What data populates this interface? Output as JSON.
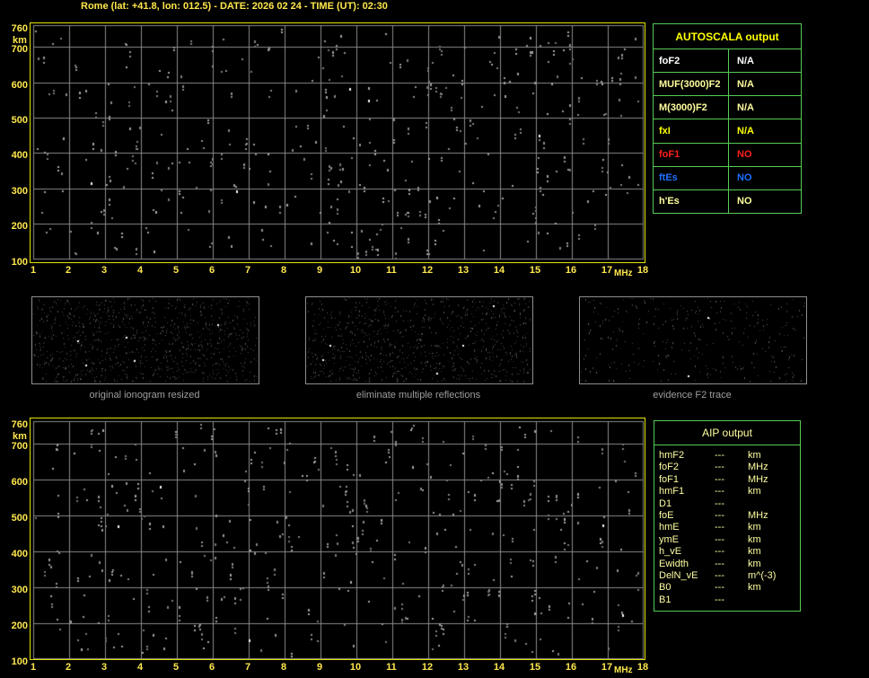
{
  "title": "Rome (lat: +41.8, lon: 012.5) - DATE: 2026 02 24 - TIME (UT): 02:30",
  "colors": {
    "background": "#000000",
    "plot_border": "#E4E400",
    "grid": "#8A8A8A",
    "axis_label": "#FFE84D",
    "table_border": "#55CC55",
    "bright_yellow": "#FFFF00",
    "pale_yellow": "#FFFF9E",
    "white": "#FFFFFF",
    "red": "#FF1F1F",
    "blue": "#1F6FFF",
    "thumb_border": "#8E8E8E",
    "caption_gray": "#9E9E9E"
  },
  "ionogram_axes": {
    "y_unit": "km",
    "x_unit": "MHz",
    "y_ticks": [
      760,
      700,
      600,
      500,
      400,
      300,
      200,
      100
    ],
    "x_ticks": [
      1,
      2,
      3,
      4,
      5,
      6,
      7,
      8,
      9,
      10,
      11,
      12,
      13,
      14,
      15,
      16,
      17,
      18
    ],
    "y_range": [
      100,
      760
    ],
    "x_range": [
      1,
      18
    ]
  },
  "autoscala_table": {
    "header": "AUTOSCALA output",
    "rows": [
      {
        "param": "foF2",
        "value": "N/A",
        "color": "#FFFFFF"
      },
      {
        "param": "MUF(3000)F2",
        "value": "N/A",
        "color": "#FFFF9E"
      },
      {
        "param": "M(3000)F2",
        "value": "N/A",
        "color": "#FFFF9E"
      },
      {
        "param": "fxI",
        "value": "N/A",
        "color": "#FFFF00"
      },
      {
        "param": "foF1",
        "value": "NO",
        "color": "#FF1F1F"
      },
      {
        "param": "ftEs",
        "value": "NO",
        "color": "#1F6FFF"
      },
      {
        "param": "h'Es",
        "value": "NO",
        "color": "#FFFF9E"
      }
    ]
  },
  "thumbnails": [
    {
      "caption": "original ionogram resized"
    },
    {
      "caption": "eliminate multiple reflections"
    },
    {
      "caption": "evidence F2 trace"
    }
  ],
  "aip_table": {
    "header": "AIP output",
    "rows": [
      {
        "param": "hmF2",
        "value": "---",
        "unit": "km"
      },
      {
        "param": "foF2",
        "value": "---",
        "unit": "MHz"
      },
      {
        "param": "foF1",
        "value": "---",
        "unit": "MHz"
      },
      {
        "param": "hmF1",
        "value": "---",
        "unit": "km"
      },
      {
        "param": "D1",
        "value": "---",
        "unit": ""
      },
      {
        "param": "foE",
        "value": "---",
        "unit": "MHz"
      },
      {
        "param": "hmE",
        "value": "---",
        "unit": "km"
      },
      {
        "param": "ymE",
        "value": "---",
        "unit": "km"
      },
      {
        "param": "h_vE",
        "value": "---",
        "unit": "km"
      },
      {
        "param": "Ewidth",
        "value": "---",
        "unit": "km"
      },
      {
        "param": "DelN_vE",
        "value": "---",
        "unit": "m^(-3)"
      },
      {
        "param": "B0",
        "value": "---",
        "unit": "km"
      },
      {
        "param": "B1",
        "value": "---",
        "unit": ""
      }
    ]
  }
}
